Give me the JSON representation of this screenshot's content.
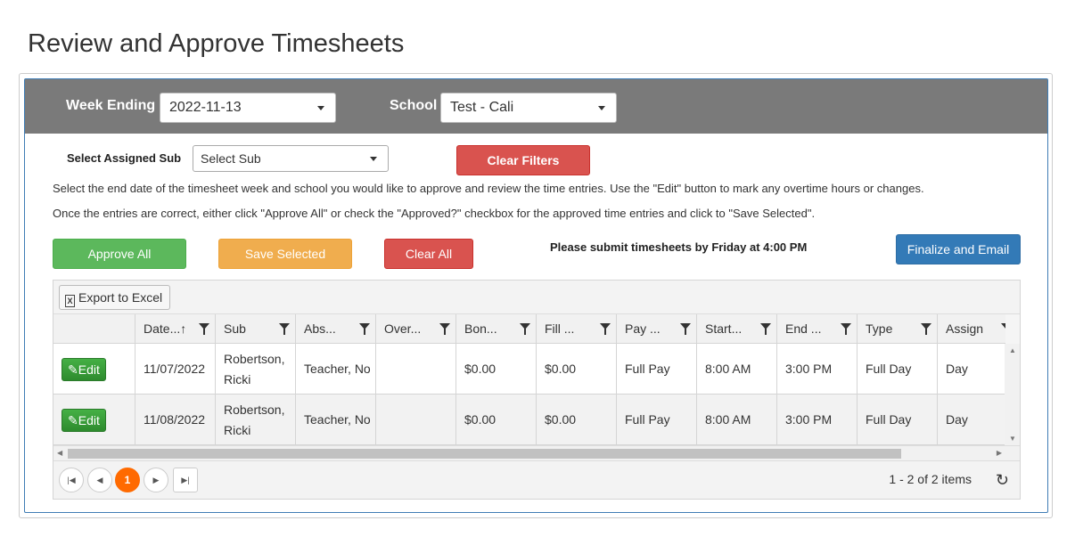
{
  "page": {
    "title": "Review and Approve Timesheets"
  },
  "filters": {
    "week_ending_label": "Week Ending",
    "week_ending_value": "2022-11-13",
    "school_label": "School",
    "school_value": "Test - Cali",
    "sub_label": "Select Assigned Sub",
    "sub_value": "Select Sub",
    "clear_filters": "Clear Filters"
  },
  "instructions": {
    "line1": "Select the end date of the timesheet week and school you would like to approve and review the time entries. Use the \"Edit\" button to mark any overtime hours or changes.",
    "line2": "Once the entries are correct, either click \"Approve All\" or check the \"Approved?\" checkbox for the approved time entries and click to \"Save Selected\"."
  },
  "actions": {
    "approve_all": "Approve All",
    "save_selected": "Save Selected",
    "clear_all": "Clear All",
    "notice": "Please submit timesheets by Friday at 4:00 PM",
    "finalize": "Finalize and Email"
  },
  "grid": {
    "export": "Export to Excel",
    "columns": [
      "Date...↑",
      "Sub",
      "Abs...",
      "Over...",
      "Bon...",
      "Fill ...",
      "Pay ...",
      "Start...",
      "End ...",
      "Type",
      "Assign"
    ],
    "edit_label": "Edit",
    "rows": [
      [
        "11/07/2022",
        "Robertson, Ricki",
        "Teacher, No",
        "",
        "$0.00",
        "$0.00",
        "Full Pay",
        "8:00 AM",
        "3:00 PM",
        "Full Day",
        "Day"
      ],
      [
        "11/08/2022",
        "Robertson, Ricki",
        "Teacher, No",
        "",
        "$0.00",
        "$0.00",
        "Full Pay",
        "8:00 AM",
        "3:00 PM",
        "Full Day",
        "Day"
      ]
    ],
    "pager": {
      "current_page": "1",
      "items_text": "1 - 2 of 2 items"
    }
  },
  "colors": {
    "header_bar": "#7a7a7a",
    "danger": "#d9534f",
    "success": "#5cb85c",
    "warning": "#f0ad4e",
    "primary": "#337ab7",
    "pager_active": "#ff6a00"
  }
}
